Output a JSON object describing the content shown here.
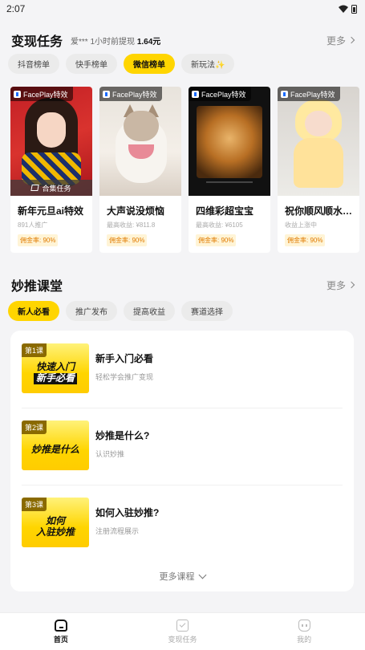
{
  "status_bar": {
    "time": "2:07"
  },
  "monetize": {
    "title": "变现任务",
    "withdraw_user": "爱***",
    "withdraw_text": " 1小时前提现 ",
    "withdraw_amount": "1.64元",
    "more": "更多",
    "tabs": [
      "抖音榜单",
      "快手榜单",
      "微信榜单",
      "新玩法✨"
    ],
    "active_tab_index": 2
  },
  "cards": [
    {
      "badge": "FacePlay特效",
      "title": "新年元旦ai特效",
      "sub": "891人推广",
      "rate": "佣金率: 90%",
      "overlay": "合集任务"
    },
    {
      "badge": "FacePlay特效",
      "title": "大声说没烦恼",
      "sub": "最高收益: ¥811.8",
      "rate": "佣金率: 90%"
    },
    {
      "badge": "FacePlay特效",
      "title": "四维彩超宝宝",
      "sub": "最高收益: ¥6105",
      "rate": "佣金率: 90%"
    },
    {
      "badge": "FacePlay特效",
      "title": "祝你顺风顺水…",
      "sub": "收益上涨中",
      "rate": "佣金率: 90%"
    }
  ],
  "classroom": {
    "title": "妙推课堂",
    "more": "更多",
    "tabs": [
      "新人必看",
      "推广发布",
      "提高收益",
      "赛道选择"
    ],
    "active_tab_index": 0,
    "lessons": [
      {
        "no": "第1课",
        "art_line1": "快速入门",
        "art_line2": "新手必看",
        "title": "新手入门必看",
        "sub": "轻松学会推广变现"
      },
      {
        "no": "第2课",
        "art_line1": "妙推是什么",
        "art_line2": "",
        "title": "妙推是什么?",
        "sub": "认识妙推"
      },
      {
        "no": "第3课",
        "art_line1": "如何",
        "art_line2": "入驻妙推",
        "title": "如何入驻妙推?",
        "sub": "注册流程展示"
      }
    ],
    "more_courses": "更多课程"
  },
  "bottom_nav": [
    {
      "label": "首页",
      "icon": "home-icon"
    },
    {
      "label": "变现任务",
      "icon": "task-icon"
    },
    {
      "label": "我的",
      "icon": "profile-icon"
    }
  ],
  "colors": {
    "accent": "#ffd500",
    "commission": "#e07b00"
  }
}
